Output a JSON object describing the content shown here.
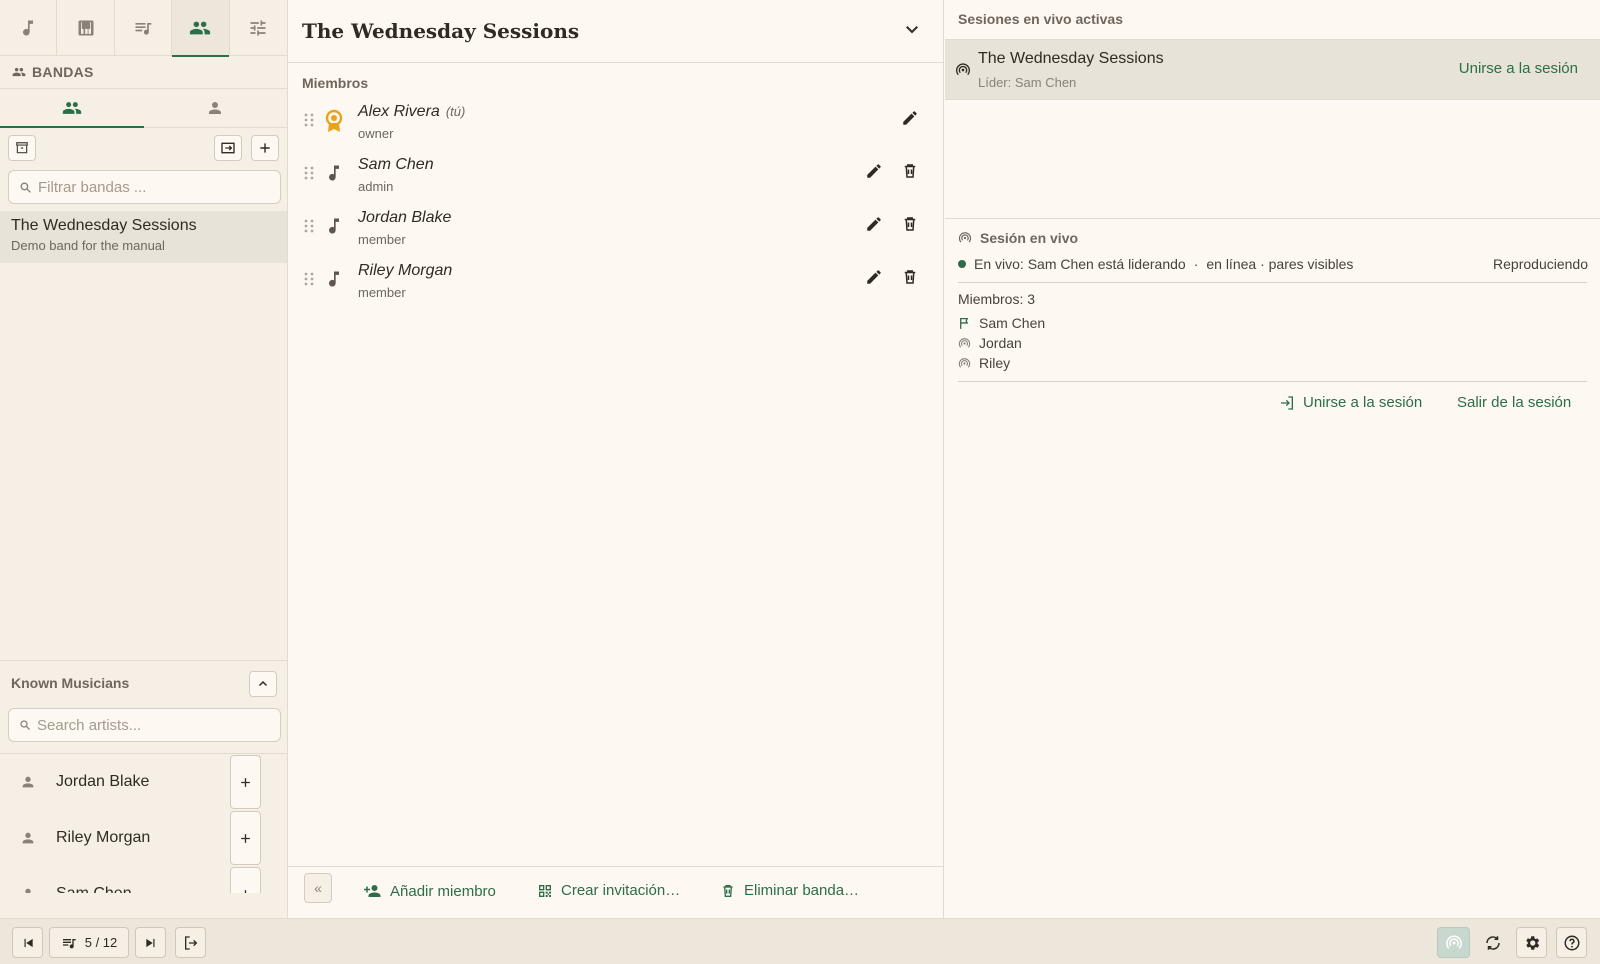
{
  "colors": {
    "accent": "#2c6e49",
    "owner_badge": "#e9a21b",
    "selected_bg": "#e7e3d8",
    "panel_bg": "#f5efe6"
  },
  "nav_tabs": [
    {
      "name": "songs",
      "icon": "music-note-icon"
    },
    {
      "name": "piano",
      "icon": "piano-icon"
    },
    {
      "name": "setlists",
      "icon": "playlist-icon"
    },
    {
      "name": "bands",
      "icon": "group-icon",
      "active": true
    },
    {
      "name": "settings",
      "icon": "tune-icon"
    }
  ],
  "bands_panel": {
    "section_label": "BANDAS",
    "filter_placeholder": "Filtrar bandas ...",
    "selected_band": {
      "name": "The Wednesday Sessions",
      "description": "Demo band for the manual"
    }
  },
  "known_musicians": {
    "title": "Known Musicians",
    "search_placeholder": "Search artists...",
    "artists": [
      "Jordan Blake",
      "Riley Morgan",
      "Sam Chen"
    ]
  },
  "band_detail": {
    "title": "The Wednesday Sessions",
    "members_label": "Miembros",
    "members": [
      {
        "name": "Alex Rivera",
        "you": "(tú)",
        "role": "owner"
      },
      {
        "name": "Sam Chen",
        "role": "admin"
      },
      {
        "name": "Jordan Blake",
        "role": "member"
      },
      {
        "name": "Riley Morgan",
        "role": "member"
      }
    ],
    "footer": {
      "collapse": "«",
      "add_member": "Añadir miembro",
      "create_invite": "Crear invitación…",
      "delete_band": "Eliminar banda…"
    }
  },
  "sessions": {
    "header": "Sesiones en vivo activas",
    "active": {
      "name": "The Wednesday Sessions",
      "leader": "Líder: Sam Chen",
      "join": "Unirse a la sesión"
    },
    "live": {
      "title": "Sesión en vivo",
      "status": "En vivo: Sam Chen está liderando",
      "connection": "en línea · pares visibles",
      "state": "Reproduciendo",
      "member_count": "Miembros: 3",
      "members": [
        {
          "name": "Sam Chen",
          "icon": "flag-icon"
        },
        {
          "name": "Jordan",
          "icon": "broadcast-icon"
        },
        {
          "name": "Riley",
          "icon": "broadcast-icon"
        }
      ],
      "join": "Unirse a la sesión",
      "leave": "Salir de la sesión"
    }
  },
  "bottom_bar": {
    "page": "5 / 12"
  }
}
